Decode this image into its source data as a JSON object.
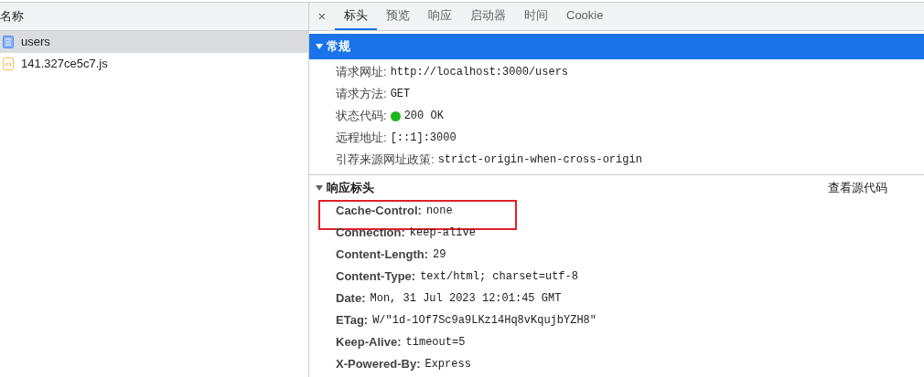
{
  "request_list": {
    "header": "名称",
    "items": [
      {
        "name": "users",
        "kind": "document",
        "selected": true
      },
      {
        "name": "141.327ce5c7.js",
        "kind": "script",
        "selected": false
      }
    ]
  },
  "detail": {
    "close": "×",
    "tabs": [
      {
        "label": "标头",
        "selected": true
      },
      {
        "label": "预览",
        "selected": false
      },
      {
        "label": "响应",
        "selected": false
      },
      {
        "label": "启动器",
        "selected": false
      },
      {
        "label": "时间",
        "selected": false
      },
      {
        "label": "Cookie",
        "selected": false
      }
    ],
    "general": {
      "title": "常规",
      "expanded": true,
      "rows": [
        {
          "kind": "text",
          "key": "请求网址:",
          "value": "http://localhost:3000/users"
        },
        {
          "kind": "text",
          "key": "请求方法:",
          "value": "GET"
        },
        {
          "kind": "status",
          "key": "状态代码:",
          "value": "200 OK"
        },
        {
          "kind": "text",
          "key": "远程地址:",
          "value": "[::1]:3000"
        },
        {
          "kind": "text",
          "key": "引荐来源网址政策:",
          "value": "strict-origin-when-cross-origin"
        }
      ]
    },
    "response_headers": {
      "title": "响应标头",
      "expanded": true,
      "view_source": "查看源代码",
      "rows": [
        {
          "key": "Cache-Control:",
          "value": "none",
          "highlighted": true
        },
        {
          "key": "Connection:",
          "value": "keep-alive",
          "highlighted": false
        },
        {
          "key": "Content-Length:",
          "value": "29",
          "highlighted": false
        },
        {
          "key": "Content-Type:",
          "value": "text/html; charset=utf-8",
          "highlighted": false
        },
        {
          "key": "Date:",
          "value": "Mon, 31 Jul 2023 12:01:45 GMT",
          "highlighted": false
        },
        {
          "key": "ETag:",
          "value": "W/\"1d-1Of7Sc9a9LKz14Hq8vKqujbYZH8\"",
          "highlighted": false
        },
        {
          "key": "Keep-Alive:",
          "value": "timeout=5",
          "highlighted": false
        },
        {
          "key": "X-Powered-By:",
          "value": "Express",
          "highlighted": false
        }
      ]
    }
  }
}
